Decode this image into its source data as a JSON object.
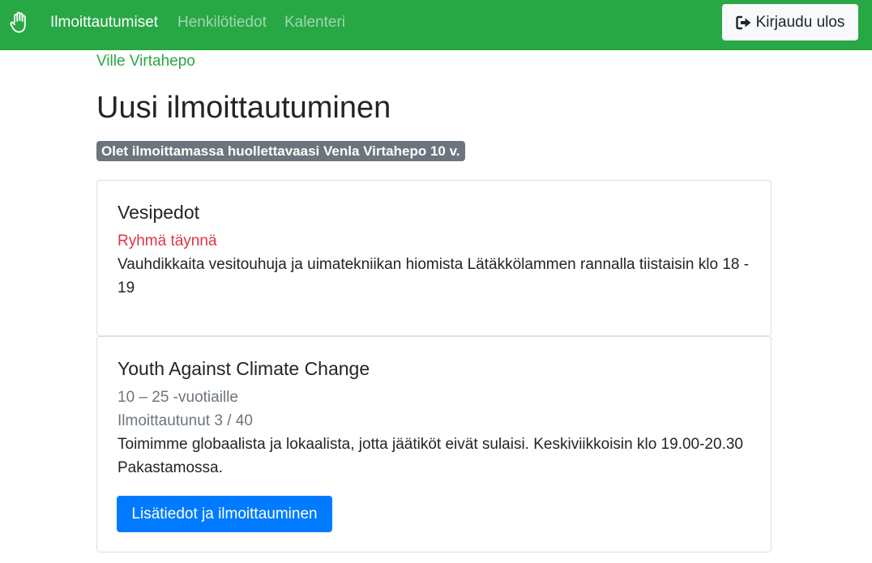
{
  "navbar": {
    "brand_icon": "hand-icon",
    "links": [
      {
        "label": "Ilmoittautumiset",
        "active": true
      },
      {
        "label": "Henkilötiedot",
        "active": false
      },
      {
        "label": "Kalenteri",
        "active": false
      }
    ],
    "logout": {
      "label": "Kirjaudu ulos",
      "icon": "sign-out-icon"
    },
    "color": "#28a745"
  },
  "user_name": "Ville Virtahepo",
  "page_title": "Uusi ilmoittautuminen",
  "notice_badge": "Olet ilmoittamassa huollettavaasi Venla Virtahepo 10 v.",
  "groups": [
    {
      "title": "Vesipedot",
      "status": "Ryhmä täynnä",
      "description": "Vauhdikkaita vesitouhuja ja uimatekniikan hiomista Lätäkkölammen rannalla tiistaisin klo 18 - 19"
    },
    {
      "title": "Youth Against Climate Change",
      "age": "10 – 25 -vuotiaille",
      "registered": "Ilmoittautunut 3 / 40",
      "description": "Toimimme globaalista ja lokaalista, jotta jäätiköt eivät sulaisi. Keskiviikkoisin klo 19.00-20.30 Pakastamossa.",
      "button_label": "Lisätiedot ja ilmoittauminen"
    }
  ],
  "colors": {
    "danger": "#dc3545",
    "muted": "#6c757d",
    "primary": "#007bff"
  }
}
